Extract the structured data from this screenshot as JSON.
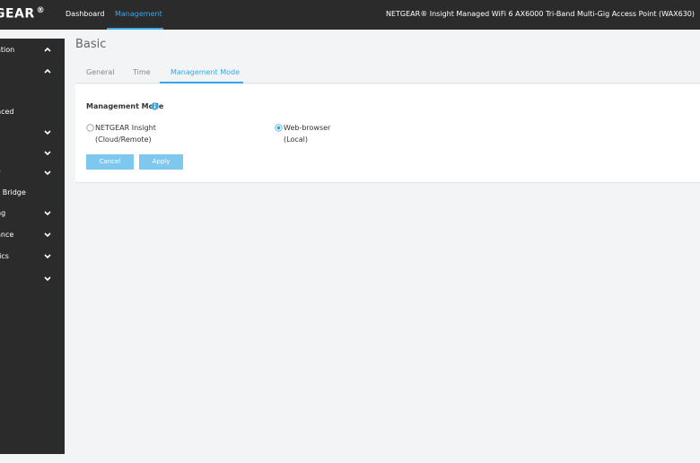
{
  "header": {
    "logo": "GEAR",
    "logo_mark": "®",
    "nav": [
      {
        "label": "Dashboard"
      },
      {
        "label": "Management"
      }
    ],
    "device_title": "NETGEAR® Insight Managed WiFi 6 AX6000 Tri-Band Multi-Gig Access Point (WAX630)"
  },
  "sidebar": {
    "items": [
      {
        "label": "ation",
        "chevron": "up"
      },
      {
        "label": "",
        "chevron": "up"
      },
      {
        "label": "c",
        "active": true
      },
      {
        "label": "nced"
      },
      {
        "label": "",
        "chevron": "down"
      },
      {
        "label": "s",
        "chevron": "down"
      },
      {
        "label": "y",
        "chevron": "down"
      },
      {
        "label": "s Bridge"
      },
      {
        "label": "ng",
        "chevron": "down"
      },
      {
        "label": "ance",
        "chevron": "down"
      },
      {
        "label": "tics",
        "chevron": "down"
      },
      {
        "label": "",
        "chevron": "down"
      }
    ]
  },
  "page": {
    "title": "Basic",
    "tabs": [
      {
        "label": "General"
      },
      {
        "label": "Time"
      },
      {
        "label": "Management Mode",
        "active": true
      }
    ]
  },
  "management_mode": {
    "title": "Management Mode",
    "options": [
      {
        "line1": "NETGEAR Insight",
        "line2": "(Cloud/Remote)",
        "selected": false
      },
      {
        "line1": "Web-browser",
        "line2": "(Local)",
        "selected": true
      }
    ],
    "cancel_label": "Cancel",
    "apply_label": "Apply"
  },
  "colors": {
    "accent": "#35a8e8",
    "button": "#7ec8f0",
    "dark": "#2b2b2b"
  }
}
